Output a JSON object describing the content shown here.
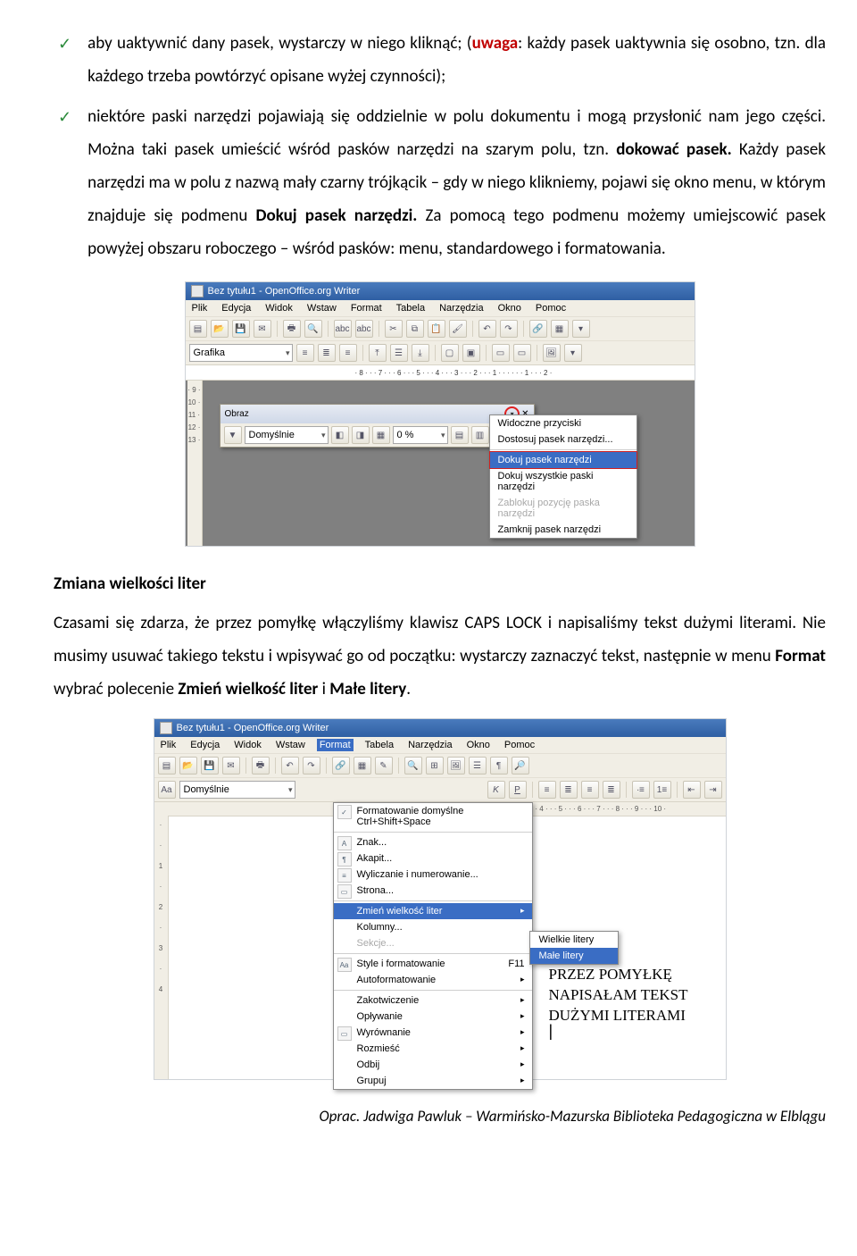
{
  "bullets": {
    "b1_pre": "aby uaktywnić dany pasek, wystarczy w niego kliknąć; (",
    "b1_uwaga": "uwaga",
    "b1_post": ": każdy pasek uaktywnia się osobno, tzn. dla każdego trzeba powtórzyć opisane wyżej czynności);",
    "b2_pre": "niektóre paski narzędzi pojawiają się oddzielnie w polu dokumentu i mogą przysłonić nam jego części. Można taki pasek umieścić wśród pasków narzędzi na szarym polu, tzn. ",
    "b2_bold1": "dokować pasek.",
    "b2_mid": " Każdy pasek narzędzi ma w polu z nazwą mały czarny trójkącik – gdy w niego klikniemy, pojawi się okno menu, w którym znajduje się podmenu ",
    "b2_bold2": "Dokuj pasek narzędzi.",
    "b2_post": " Za pomocą tego podmenu możemy umiejscowić pasek powyżej obszaru roboczego – wśród pasków: menu, standardowego i formatowania."
  },
  "shot1": {
    "title": "Bez tytułu1 - OpenOffice.org Writer",
    "menu": [
      "Plik",
      "Edycja",
      "Widok",
      "Wstaw",
      "Format",
      "Tabela",
      "Narzędzia",
      "Okno",
      "Pomoc"
    ],
    "combo_style": "Grafika",
    "ruler": "· 8 · · · 7 · · · 6 · · · 5 · · · 4 · · · 3 · · · 2 · · · 1 · · · · · · 1 · · · 2 ·",
    "vruler": [
      "· 9 ·",
      "10 ·",
      "11 ·",
      "12 ·",
      "13 ·"
    ],
    "float_title": "Obraz",
    "float_combo": "Domyślnie",
    "float_pct": "0 %",
    "ctx": {
      "m1": "Widoczne przyciski",
      "m2": "Dostosuj pasek narzędzi...",
      "m3": "Dokuj pasek narzędzi",
      "m4": "Dokuj wszystkie paski narzędzi",
      "m5": "Zablokuj pozycję paska narzędzi",
      "m6": "Zamknij pasek narzędzi"
    }
  },
  "heading2": "Zmiana wielkości liter",
  "para2_pre": "Czasami się zdarza, że przez pomyłkę włączyliśmy klawisz CAPS LOCK i napisaliśmy tekst dużymi literami. Nie musimy usuwać takiego tekstu i wpisywać go od początku: wystarczy zaznaczyć tekst, następnie w menu ",
  "para2_b1": "Format",
  "para2_mid": " wybrać polecenie ",
  "para2_b2": "Zmień wielkość liter",
  "para2_mid2": " i ",
  "para2_b3": "Małe litery",
  "para2_end": ".",
  "shot2": {
    "title": "Bez tytułu1 - OpenOffice.org Writer",
    "menu": [
      "Plik",
      "Edycja",
      "Widok",
      "Wstaw",
      "Format",
      "Tabela",
      "Narzędzia",
      "Okno",
      "Pomoc"
    ],
    "combo_style": "Domyślnie",
    "ruler": "· · 4 · · · 5 · · · 6 · · · 7 · · · 8 · · · 9 · · · 10 ·",
    "vruler": [
      "·",
      "·",
      "1",
      "·",
      "2",
      "·",
      "3",
      "·",
      "4"
    ],
    "fmt": {
      "m1": "Formatowanie domyślne   Ctrl+Shift+Space",
      "m2": "Znak...",
      "m3": "Akapit...",
      "m4": "Wyliczanie i numerowanie...",
      "m5": "Strona...",
      "m6": "Zmień wielkość liter",
      "m7": "Kolumny...",
      "m8": "Sekcje...",
      "m9": "Style i formatowanie",
      "m9k": "F11",
      "m10": "Autoformatowanie",
      "m11": "Zakotwiczenie",
      "m12": "Opływanie",
      "m13": "Wyrównanie",
      "m14": "Rozmieść",
      "m15": "Odbij",
      "m16": "Grupuj"
    },
    "sub": {
      "s1": "Wielkie litery",
      "s2": "Małe litery"
    },
    "page_text_l1": "PRZEZ POMYŁKĘ",
    "page_text_l2": "NAPISAŁAM TEKST",
    "page_text_l3": "DUŻYMI LITERAMI"
  },
  "footer": "Oprac. Jadwiga Pawluk – Warmińsko-Mazurska Biblioteka Pedagogiczna w Elblągu"
}
